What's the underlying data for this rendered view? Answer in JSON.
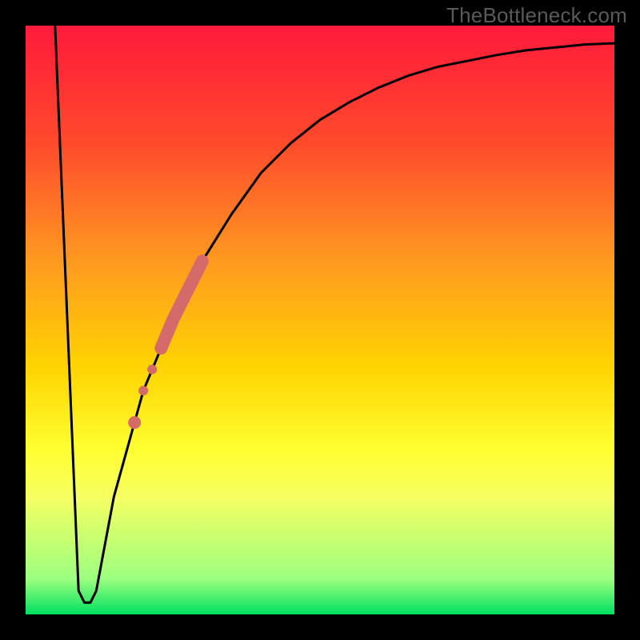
{
  "watermark": {
    "text": "TheBottleneck.com"
  },
  "colors": {
    "gradient_top": "#ff1a3a",
    "gradient_mid1": "#ff7a28",
    "gradient_mid2": "#ffd400",
    "gradient_mid3": "#ffff30",
    "gradient_mid4": "#d8ff60",
    "gradient_bottom": "#00e060",
    "frame": "#000000",
    "curve": "#000000",
    "highlight": "#d46a6a"
  },
  "chart_data": {
    "type": "line",
    "title": "",
    "xlabel": "",
    "ylabel": "",
    "xlim": [
      0,
      100
    ],
    "ylim": [
      0,
      100
    ],
    "grid": false,
    "legend": false,
    "curve": [
      {
        "x": 5,
        "y": 100
      },
      {
        "x": 9,
        "y": 4
      },
      {
        "x": 10,
        "y": 2
      },
      {
        "x": 11,
        "y": 2
      },
      {
        "x": 12,
        "y": 4
      },
      {
        "x": 15,
        "y": 20
      },
      {
        "x": 20,
        "y": 38
      },
      {
        "x": 25,
        "y": 50
      },
      {
        "x": 30,
        "y": 60
      },
      {
        "x": 35,
        "y": 68
      },
      {
        "x": 40,
        "y": 75
      },
      {
        "x": 45,
        "y": 80
      },
      {
        "x": 50,
        "y": 84
      },
      {
        "x": 55,
        "y": 87
      },
      {
        "x": 60,
        "y": 89.5
      },
      {
        "x": 65,
        "y": 91.5
      },
      {
        "x": 70,
        "y": 93
      },
      {
        "x": 75,
        "y": 94
      },
      {
        "x": 80,
        "y": 95
      },
      {
        "x": 85,
        "y": 95.8
      },
      {
        "x": 90,
        "y": 96.3
      },
      {
        "x": 95,
        "y": 96.8
      },
      {
        "x": 100,
        "y": 97
      }
    ],
    "highlight_segment": {
      "x_start": 23,
      "x_end": 30
    },
    "highlight_dots": [
      {
        "x": 21.5,
        "r": 6
      },
      {
        "x": 20.0,
        "r": 6
      },
      {
        "x": 18.5,
        "r": 8
      }
    ]
  }
}
